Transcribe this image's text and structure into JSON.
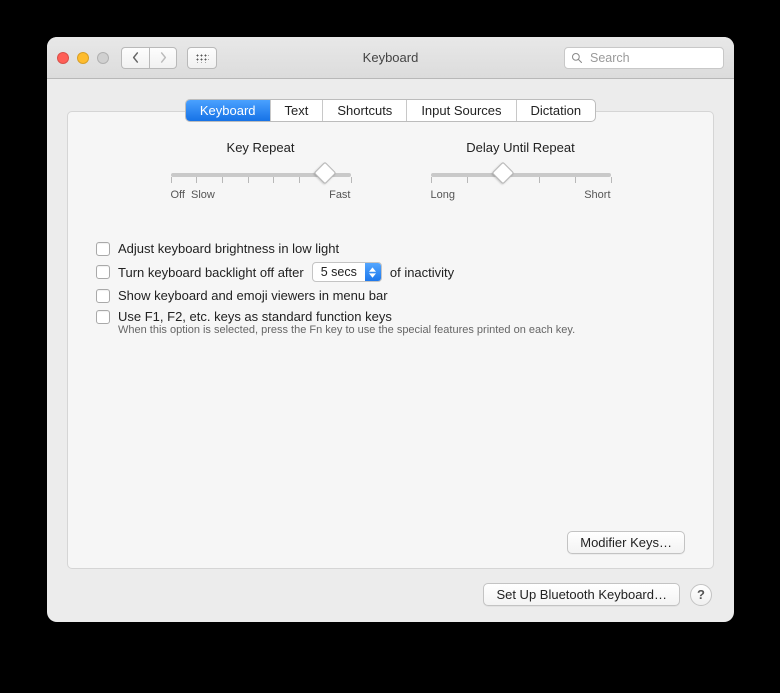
{
  "window": {
    "title": "Keyboard"
  },
  "search": {
    "placeholder": "Search"
  },
  "tabs": [
    {
      "label": "Keyboard",
      "active": true
    },
    {
      "label": "Text"
    },
    {
      "label": "Shortcuts"
    },
    {
      "label": "Input Sources"
    },
    {
      "label": "Dictation"
    }
  ],
  "sliders": {
    "key_repeat": {
      "label": "Key Repeat",
      "min_label_a": "Off",
      "min_label_b": "Slow",
      "max_label": "Fast",
      "ticks": 8,
      "value_index": 6
    },
    "delay_until_repeat": {
      "label": "Delay Until Repeat",
      "min_label": "Long",
      "max_label": "Short",
      "ticks": 6,
      "value_index": 2
    }
  },
  "options": {
    "brightness_low_light": "Adjust keyboard brightness in low light",
    "backlight_off_prefix": "Turn keyboard backlight off after",
    "backlight_off_value": "5 secs",
    "backlight_off_suffix": "of inactivity",
    "show_viewers": "Show keyboard and emoji viewers in menu bar",
    "fn_keys": "Use F1, F2, etc. keys as standard function keys",
    "fn_keys_hint": "When this option is selected, press the Fn key to use the special features printed on each key."
  },
  "buttons": {
    "modifier_keys": "Modifier Keys…",
    "bluetooth": "Set Up Bluetooth Keyboard…",
    "help": "?"
  }
}
